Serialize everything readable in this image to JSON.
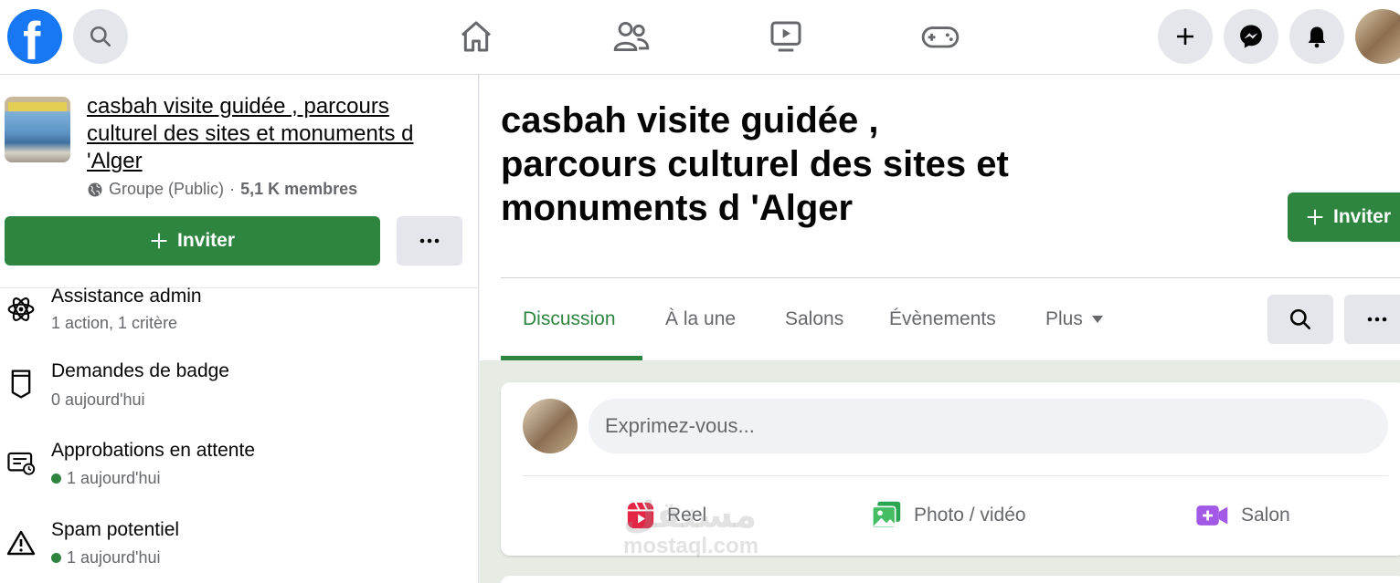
{
  "topbar": {
    "logo_letter": "f",
    "nav": [
      "home-icon",
      "friends-icon",
      "watch-icon",
      "gaming-icon"
    ],
    "right": [
      "create-icon",
      "messenger-icon",
      "notifications-icon"
    ]
  },
  "group": {
    "name": "casbah visite guidée , parcours culturel des sites et monuments d 'Alger",
    "privacy": "Groupe (Public)",
    "separator": "·",
    "members": "5,1 K membres",
    "invite_label": "Inviter",
    "more_label": "···"
  },
  "admin_items": [
    {
      "title": "Assistance admin",
      "sub": "1 action, 1 critère",
      "icon": "atom-icon",
      "dot": false
    },
    {
      "title": "Demandes de badge",
      "sub": "0 aujourd'hui",
      "icon": "badge-icon",
      "dot": false
    },
    {
      "title": "Approbations en attente",
      "sub": "1 aujourd'hui",
      "icon": "approval-icon",
      "dot": true
    },
    {
      "title": "Spam potentiel",
      "sub": "1 aujourd'hui",
      "icon": "warning-icon",
      "dot": true
    }
  ],
  "main": {
    "title": "casbah visite guidée , parcours culturel des sites et monuments d 'Alger",
    "invite_label": "Inviter",
    "tabs": [
      {
        "label": "Discussion",
        "active": true
      },
      {
        "label": "À la une",
        "active": false
      },
      {
        "label": "Salons",
        "active": false
      },
      {
        "label": "Évènements",
        "active": false
      },
      {
        "label": "Plus",
        "active": false
      }
    ],
    "more_label": "···"
  },
  "composer": {
    "placeholder": "Exprimez-vous...",
    "actions": [
      {
        "label": "Reel",
        "icon": "reel-icon"
      },
      {
        "label": "Photo / vidéo",
        "icon": "photo-icon"
      },
      {
        "label": "Salon",
        "icon": "video-room-icon"
      }
    ]
  },
  "colors": {
    "accent_green": "#2e8540",
    "fb_blue": "#1877f2",
    "gray_btn": "#e4e6eb",
    "text_secondary": "#65676b"
  },
  "watermark": {
    "arabic": "مستقل",
    "latin": "mostaql.com"
  }
}
